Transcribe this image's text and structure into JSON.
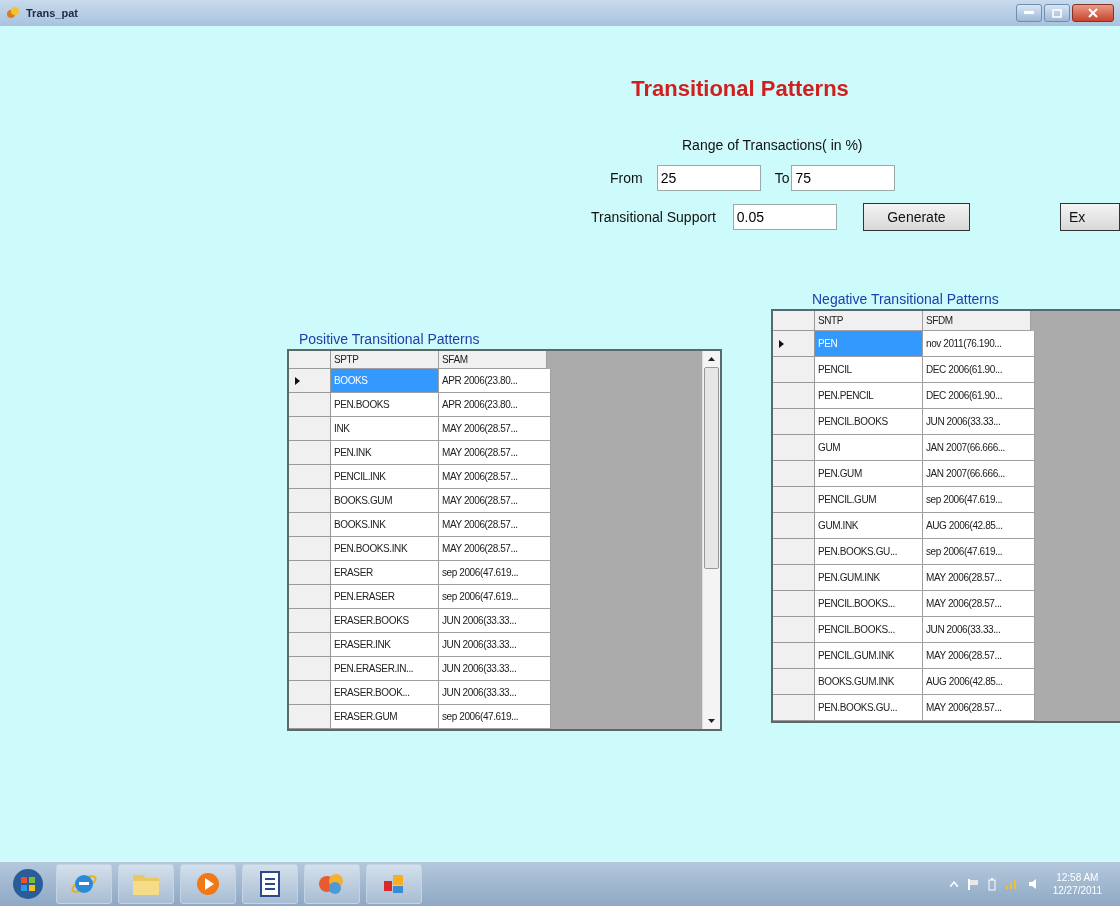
{
  "window": {
    "title": "Trans_pat"
  },
  "heading": "Transitional Patterns",
  "range": {
    "label": "Range of Transactions( in %)",
    "from_label": "From",
    "from_value": "25",
    "to_label": "To",
    "to_value": "75"
  },
  "support": {
    "label": "Transitional Support",
    "value": "0.05"
  },
  "buttons": [
    "Generate",
    "Ex"
  ],
  "grids": [
    {
      "label": "Positive Transitional Patterns",
      "scrollbar": true,
      "columns": [
        "SPTP",
        "SFAM"
      ],
      "rows": [
        {
          "cells": [
            "BOOKS",
            "APR 2006(23.80..."
          ],
          "selected": true
        },
        {
          "cells": [
            "PEN.BOOKS",
            "APR 2006(23.80..."
          ],
          "selected": false
        },
        {
          "cells": [
            "INK",
            "MAY 2006(28.57..."
          ],
          "selected": false
        },
        {
          "cells": [
            "PEN.INK",
            "MAY 2006(28.57..."
          ],
          "selected": false
        },
        {
          "cells": [
            "PENCIL.INK",
            "MAY 2006(28.57..."
          ],
          "selected": false
        },
        {
          "cells": [
            "BOOKS.GUM",
            "MAY 2006(28.57..."
          ],
          "selected": false
        },
        {
          "cells": [
            "BOOKS.INK",
            "MAY 2006(28.57..."
          ],
          "selected": false
        },
        {
          "cells": [
            "PEN.BOOKS.INK",
            "MAY 2006(28.57..."
          ],
          "selected": false
        },
        {
          "cells": [
            "ERASER",
            "sep 2006(47.619..."
          ],
          "selected": false
        },
        {
          "cells": [
            "PEN.ERASER",
            "sep 2006(47.619..."
          ],
          "selected": false
        },
        {
          "cells": [
            "ERASER.BOOKS",
            "JUN 2006(33.33..."
          ],
          "selected": false
        },
        {
          "cells": [
            "ERASER.INK",
            "JUN 2006(33.33..."
          ],
          "selected": false
        },
        {
          "cells": [
            "PEN.ERASER.IN...",
            "JUN 2006(33.33..."
          ],
          "selected": false
        },
        {
          "cells": [
            "ERASER.BOOK...",
            "JUN 2006(33.33..."
          ],
          "selected": false
        },
        {
          "cells": [
            "ERASER.GUM",
            "sep 2006(47.619..."
          ],
          "selected": false
        }
      ]
    },
    {
      "label": "Negative Transitional Patterns",
      "scrollbar": false,
      "columns": [
        "SNTP",
        "SFDM"
      ],
      "rows": [
        {
          "cells": [
            "PEN",
            "nov 2011(76.190..."
          ],
          "selected": true
        },
        {
          "cells": [
            "PENCIL",
            "DEC 2006(61.90..."
          ],
          "selected": false
        },
        {
          "cells": [
            "PEN.PENCIL",
            "DEC 2006(61.90..."
          ],
          "selected": false
        },
        {
          "cells": [
            "PENCIL.BOOKS",
            "JUN 2006(33.33..."
          ],
          "selected": false
        },
        {
          "cells": [
            "GUM",
            "JAN 2007(66.666..."
          ],
          "selected": false
        },
        {
          "cells": [
            "PEN.GUM",
            "JAN 2007(66.666..."
          ],
          "selected": false
        },
        {
          "cells": [
            "PENCIL.GUM",
            "sep 2006(47.619..."
          ],
          "selected": false
        },
        {
          "cells": [
            "GUM.INK",
            "AUG 2006(42.85..."
          ],
          "selected": false
        },
        {
          "cells": [
            "PEN.BOOKS.GU...",
            "sep 2006(47.619..."
          ],
          "selected": false
        },
        {
          "cells": [
            "PEN.GUM.INK",
            "MAY 2006(28.57..."
          ],
          "selected": false
        },
        {
          "cells": [
            "PENCIL.BOOKS...",
            "MAY 2006(28.57..."
          ],
          "selected": false
        },
        {
          "cells": [
            "PENCIL.BOOKS...",
            "JUN 2006(33.33..."
          ],
          "selected": false
        },
        {
          "cells": [
            "PENCIL.GUM.INK",
            "MAY 2006(28.57..."
          ],
          "selected": false
        },
        {
          "cells": [
            "BOOKS.GUM.INK",
            "AUG 2006(42.85..."
          ],
          "selected": false
        },
        {
          "cells": [
            "PEN.BOOKS.GU...",
            "MAY 2006(28.57..."
          ],
          "selected": false
        }
      ]
    }
  ],
  "taskbar": {
    "time": "12:58 AM",
    "date": "12/27/2011"
  }
}
